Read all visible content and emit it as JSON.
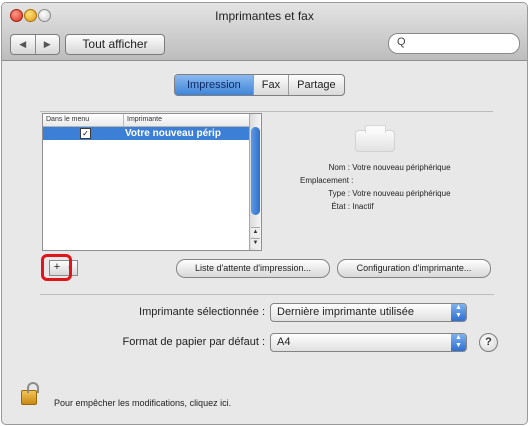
{
  "window": {
    "title": "Imprimantes et fax"
  },
  "toolbar": {
    "back_icon": "back-arrow-icon",
    "forward_icon": "forward-arrow-icon",
    "show_all_label": "Tout afficher",
    "search_placeholder": "",
    "search_icon": "search-icon"
  },
  "tabs": [
    {
      "label": "Impression",
      "active": true
    },
    {
      "label": "Fax",
      "active": false
    },
    {
      "label": "Partage",
      "active": false
    }
  ],
  "printer_list": {
    "headers": [
      "Dans le menu",
      "Imprimante"
    ],
    "rows": [
      {
        "in_menu": true,
        "name": "Votre nouveau périp",
        "selected": true
      }
    ]
  },
  "details": {
    "icon": "printer-icon",
    "name_label": "Nom :",
    "name_value": "Votre nouveau périphérique",
    "location_label": "Emplacement :",
    "location_value": "",
    "type_label": "Type :",
    "type_value": "Votre nouveau périphérique",
    "state_label": "État :",
    "state_value": "Inactif"
  },
  "actions": {
    "add_label": "+",
    "remove_label": "-",
    "queue_label": "Liste d'attente d'impression...",
    "config_label": "Configuration d'imprimante..."
  },
  "settings": {
    "selected_printer_label": "Imprimante sélectionnée :",
    "selected_printer_value": "Dernière imprimante utilisée",
    "paper_format_label": "Format de papier par défaut :",
    "paper_format_value": "A4"
  },
  "help_label": "?",
  "lock": {
    "icon": "lock-icon",
    "text": "Pour empêcher les modifications, cliquez ici."
  },
  "colors": {
    "selection": "#3c7fd6",
    "highlight_ring": "#e0151b",
    "active_tab": "#3f84d8"
  }
}
